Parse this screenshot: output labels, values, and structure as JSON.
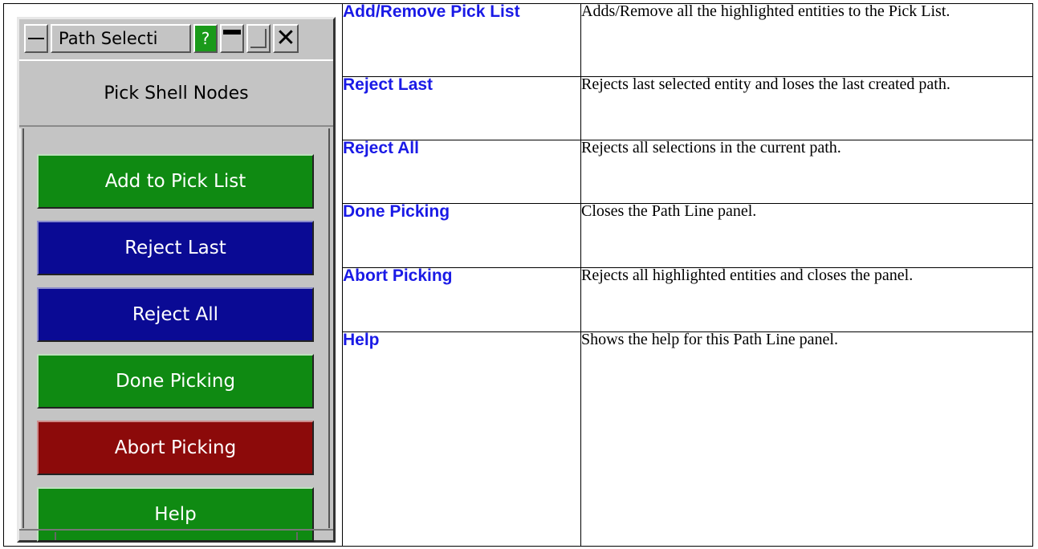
{
  "panel": {
    "title": "Path Selecti",
    "help_label": "?",
    "subtitle": "Pick Shell Nodes",
    "buttons": [
      {
        "label": "Add to Pick List",
        "color": "#0f8a12"
      },
      {
        "label": "Reject Last",
        "color": "#0a0a94"
      },
      {
        "label": "Reject All",
        "color": "#0a0a94"
      },
      {
        "label": "Done Picking",
        "color": "#0f8a12"
      },
      {
        "label": "Abort Picking",
        "color": "#8c0a0a"
      },
      {
        "label": "Help",
        "color": "#0f8a12"
      }
    ]
  },
  "rows": [
    {
      "term": "Add/Remove Pick List",
      "definition": "Adds/Remove all the highlighted entities to the Pick List."
    },
    {
      "term": "Reject Last",
      "definition": "Rejects last selected entity and loses the last created path."
    },
    {
      "term": "Reject All",
      "definition": "Rejects all selections in the current path."
    },
    {
      "term": "Done Picking",
      "definition": "Closes the Path Line panel."
    },
    {
      "term": "Abort Picking",
      "definition": "Rejects all highlighted entities and closes the panel."
    },
    {
      "term": "Help",
      "definition": "Shows the help for this Path Line panel."
    }
  ],
  "colors": {
    "term_text": "#1a1ae6"
  }
}
